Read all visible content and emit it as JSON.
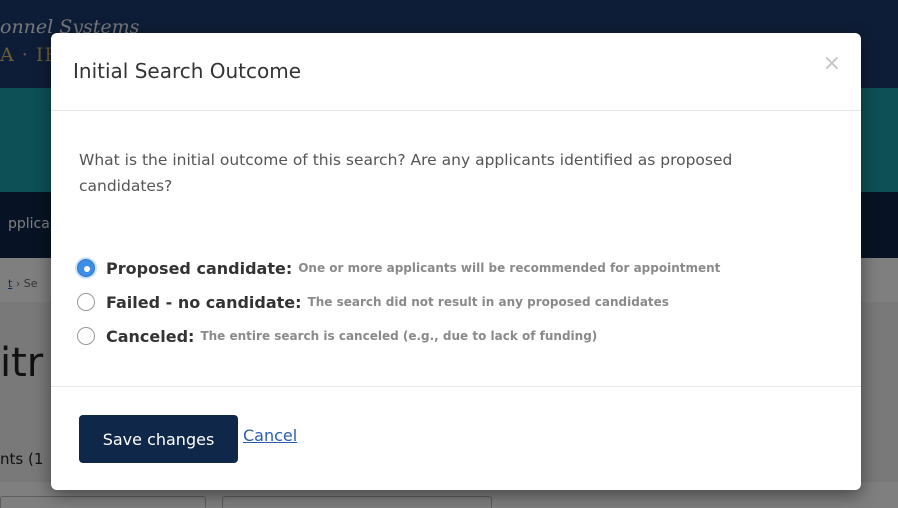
{
  "background": {
    "header_title": "onnel Systems",
    "header_subtitle": "A · IR",
    "nav_item": "pplica",
    "breadcrumb_link": "t",
    "breadcrumb_rest": " › Se",
    "page_title": "itr",
    "count_text": "nts (1"
  },
  "modal": {
    "title": "Initial Search Outcome",
    "close_symbol": "×",
    "question": "What is the initial outcome of this search? Are any applicants identified as proposed candidates?",
    "options": [
      {
        "label": "Proposed candidate:",
        "description": "One or more applicants will be recommended for appointment",
        "selected": true
      },
      {
        "label": "Failed - no candidate:",
        "description": "The search did not result in any proposed candidates",
        "selected": false
      },
      {
        "label": "Canceled:",
        "description": "The entire search is canceled (e.g., due to lack of funding)",
        "selected": false
      }
    ],
    "save_label": "Save changes",
    "cancel_label": "Cancel"
  },
  "colors": {
    "header": "#1d3a6e",
    "teal_band": "#1ba1ad",
    "nav": "#0f2749",
    "primary_button": "#0f2749",
    "link": "#2a5db0",
    "radio_selected": "#3d8ee8"
  },
  "icons": {
    "close": "close-icon",
    "radio": "radio-icon"
  }
}
